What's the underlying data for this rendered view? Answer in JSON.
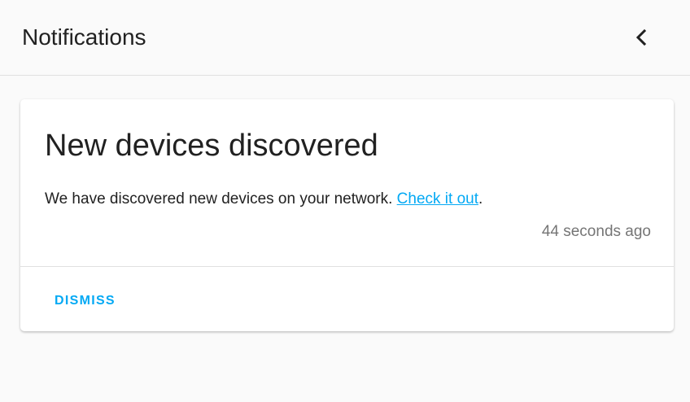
{
  "header": {
    "title": "Notifications",
    "close_icon": "chevron-left-icon"
  },
  "notification": {
    "title": "New devices discovered",
    "message": "We have discovered new devices on your network. ",
    "link_text": "Check it out",
    "message_suffix": ".",
    "timestamp": "44 seconds ago",
    "dismiss_label": "DISMISS"
  },
  "colors": {
    "accent": "#03a9f4",
    "text": "#212121",
    "secondary_text": "#757575",
    "background": "#fafafa",
    "card": "#ffffff",
    "divider": "#e0e0e0"
  }
}
